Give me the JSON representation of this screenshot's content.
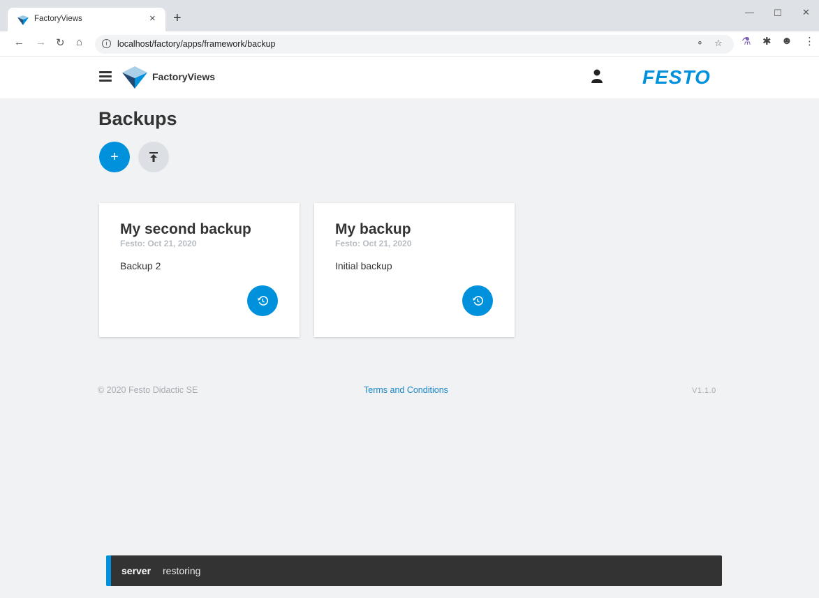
{
  "browser": {
    "tab_title": "FactoryViews",
    "tab_close": "×",
    "new_tab": "+",
    "url": "localhost/factory/apps/framework/backup",
    "icons": [
      "back-icon",
      "forward-icon",
      "reload-icon",
      "home-icon",
      "info-icon",
      "key-icon",
      "star-icon",
      "lab-icon",
      "puzzle-icon",
      "profile-icon",
      "menu-icon"
    ]
  },
  "header": {
    "app_name": "FactoryViews",
    "brand": "FESTO"
  },
  "main": {
    "title": "Backups",
    "add_label": "+",
    "cards": [
      {
        "title": "My second backup",
        "subtitle": "Festo: Oct 21, 2020",
        "description": "Backup 2"
      },
      {
        "title": "My backup",
        "subtitle": "Festo: Oct 21, 2020",
        "description": "Initial backup"
      }
    ]
  },
  "footer": {
    "copyright": "© 2020 Festo Didactic SE",
    "terms": "Terms and Conditions",
    "version": "V1.1.0"
  },
  "snackbar": {
    "source": "server",
    "message": "restoring"
  },
  "colors": {
    "accent": "#0091dc",
    "background": "#f0f2f4",
    "snackbar": "#333333"
  }
}
